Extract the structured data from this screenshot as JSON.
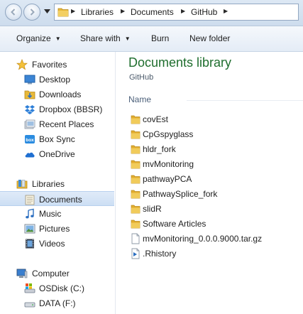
{
  "address_bar": {
    "breadcrumbs": [
      "Libraries",
      "Documents",
      "GitHub"
    ]
  },
  "toolbar": {
    "organize_label": "Organize",
    "share_label": "Share with",
    "burn_label": "Burn",
    "new_folder_label": "New folder"
  },
  "nav": {
    "favorites": {
      "label": "Favorites",
      "items": [
        {
          "label": "Desktop",
          "icon": "desktop-icon"
        },
        {
          "label": "Downloads",
          "icon": "downloads-icon"
        },
        {
          "label": "Dropbox (BBSR)",
          "icon": "dropbox-icon"
        },
        {
          "label": "Recent Places",
          "icon": "recent-places-icon"
        },
        {
          "label": "Box Sync",
          "icon": "box-icon"
        },
        {
          "label": "OneDrive",
          "icon": "onedrive-icon"
        }
      ]
    },
    "libraries": {
      "label": "Libraries",
      "items": [
        {
          "label": "Documents",
          "icon": "documents-icon",
          "selected": true
        },
        {
          "label": "Music",
          "icon": "music-icon"
        },
        {
          "label": "Pictures",
          "icon": "pictures-icon"
        },
        {
          "label": "Videos",
          "icon": "videos-icon"
        }
      ]
    },
    "computer": {
      "label": "Computer",
      "items": [
        {
          "label": "OSDisk (C:)",
          "icon": "system-drive-icon"
        },
        {
          "label": "DATA (F:)",
          "icon": "drive-icon"
        }
      ]
    }
  },
  "content": {
    "title": "Documents library",
    "subtitle": "GitHub",
    "column_header": "Name",
    "files": [
      {
        "name": "covEst",
        "type": "folder"
      },
      {
        "name": "CpGspyglass",
        "type": "folder"
      },
      {
        "name": "hldr_fork",
        "type": "folder"
      },
      {
        "name": "mvMonitoring",
        "type": "folder"
      },
      {
        "name": "pathwayPCA",
        "type": "folder"
      },
      {
        "name": "PathwaySplice_fork",
        "type": "folder"
      },
      {
        "name": "slidR",
        "type": "folder"
      },
      {
        "name": "Software Articles",
        "type": "folder"
      },
      {
        "name": "mvMonitoring_0.0.0.9000.tar.gz",
        "type": "file"
      },
      {
        "name": ".Rhistory",
        "type": "rhistory"
      }
    ]
  },
  "colors": {
    "title_green": "#1f6e2e",
    "folder_yellow": "#e8b93a",
    "selection_blue": "#cddff4"
  }
}
